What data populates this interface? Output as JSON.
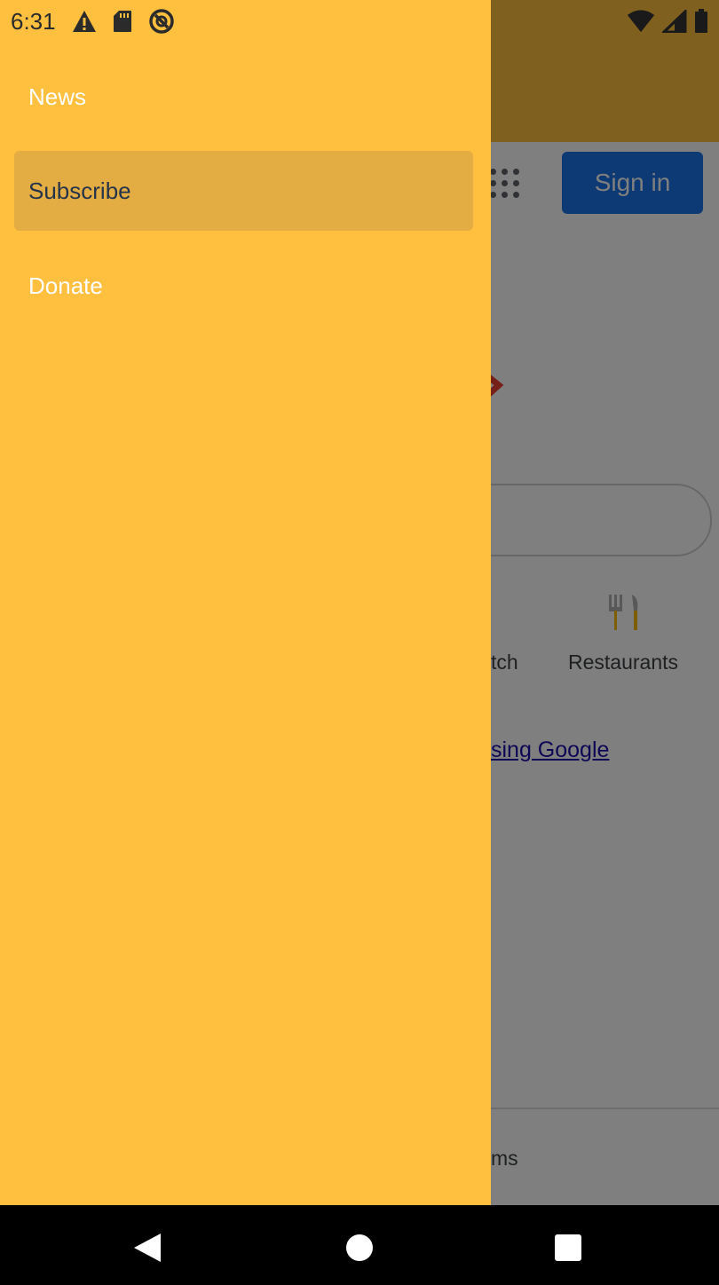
{
  "status_bar": {
    "time": "6:31",
    "icons_left": [
      "warning-icon",
      "sd-card-icon",
      "data-saver-icon"
    ],
    "icons_right": [
      "wifi-icon",
      "signal-icon",
      "battery-icon"
    ]
  },
  "drawer": {
    "items": [
      {
        "label": "News",
        "selected": false
      },
      {
        "label": "Subscribe",
        "selected": true
      },
      {
        "label": "Donate",
        "selected": false
      }
    ],
    "background_color": "#ffbf3f",
    "selected_color": "#e3ad44"
  },
  "background_page": {
    "sign_in_label": "Sign in",
    "shortcut_partial_label": "tch",
    "restaurants_label": "Restaurants",
    "link_partial_text": "sing Google",
    "footer_partial_text": "ms",
    "accent_color": "#1a73e8"
  },
  "navbar": {
    "buttons": [
      "back-icon",
      "home-icon",
      "recents-icon"
    ]
  }
}
